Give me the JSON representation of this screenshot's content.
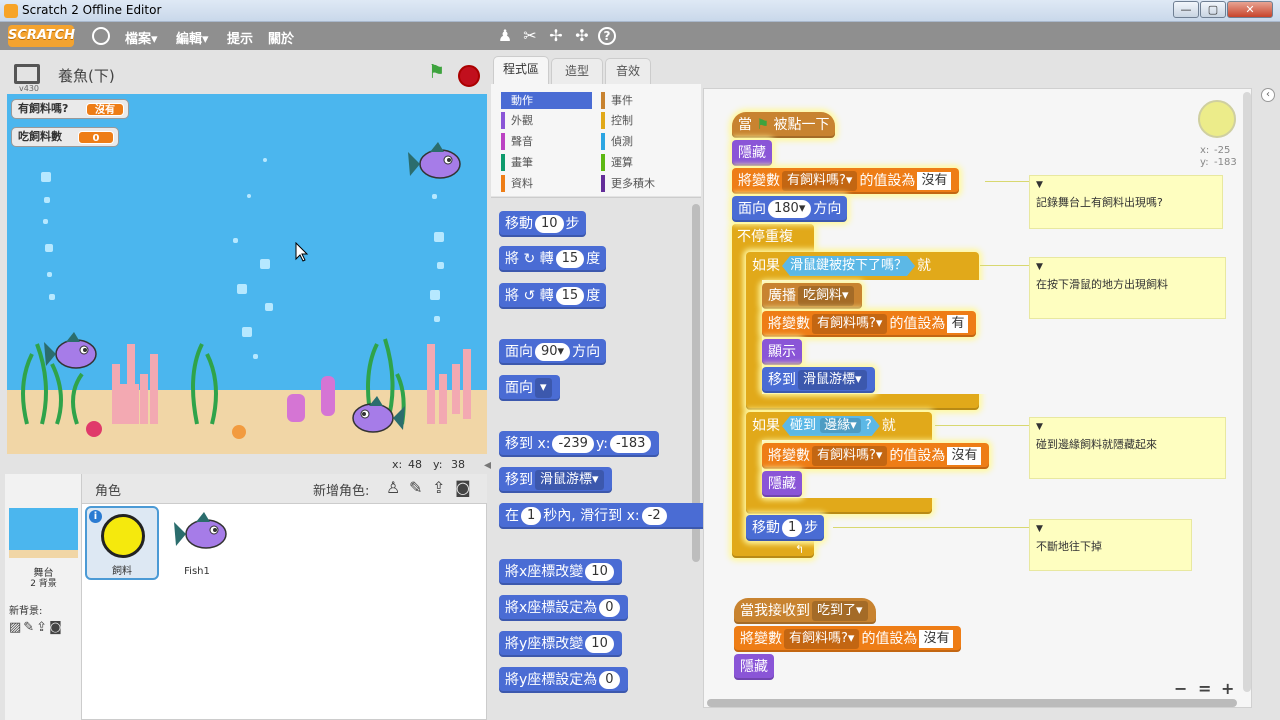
{
  "window": {
    "title": "Scratch 2 Offline Editor",
    "min": "—",
    "max": "▢",
    "close": "✕"
  },
  "menubar": {
    "logo": "SCRATCH",
    "items": [
      "檔案▾",
      "編輯▾",
      "提示",
      "關於"
    ],
    "tools": [
      "duplicate-stamp-icon",
      "cut-scissors-icon",
      "grow-icon",
      "shrink-icon",
      "help-icon"
    ]
  },
  "stage": {
    "title": "養魚(下)",
    "version": "v430",
    "watchers": [
      {
        "label": "有飼料嗎?",
        "value": "沒有"
      },
      {
        "label": "吃飼料數",
        "value": "0"
      }
    ],
    "mouse_x_label": "x:",
    "mouse_x": "48",
    "mouse_y_label": "y:",
    "mouse_y": "38"
  },
  "sprites": {
    "header": "角色",
    "new_sprite_label": "新增角色:",
    "stage_label": "舞台",
    "stage_backdrops": "2 背景",
    "new_backdrop_label": "新背景:",
    "list": [
      {
        "name": "飼料",
        "selected": true
      },
      {
        "name": "Fish1",
        "selected": false
      }
    ]
  },
  "tabs": [
    "程式區",
    "造型",
    "音效"
  ],
  "categories": [
    {
      "name": "動作",
      "color": "#4a6cd4",
      "active": true
    },
    {
      "name": "事件",
      "color": "#c88330"
    },
    {
      "name": "外觀",
      "color": "#8a55d7"
    },
    {
      "name": "控制",
      "color": "#e1a91a"
    },
    {
      "name": "聲音",
      "color": "#bb42c3"
    },
    {
      "name": "偵測",
      "color": "#2ca5e2"
    },
    {
      "name": "畫筆",
      "color": "#0e9a6c"
    },
    {
      "name": "運算",
      "color": "#5cb712"
    },
    {
      "name": "資料",
      "color": "#ee7d16"
    },
    {
      "name": "更多積木",
      "color": "#632d99"
    }
  ],
  "palette": {
    "move": {
      "a": "移動",
      "n": "10",
      "b": "步"
    },
    "turn_cw": {
      "a": "將",
      "icon": "↻",
      "b": "轉",
      "n": "15",
      "c": "度"
    },
    "turn_ccw": {
      "a": "將",
      "icon": "↺",
      "b": "轉",
      "n": "15",
      "c": "度"
    },
    "point_dir": {
      "a": "面向",
      "n": "90▾",
      "b": "方向"
    },
    "point_to": {
      "a": "面向",
      "d": "▾"
    },
    "goto_xy": {
      "a": "移到 x:",
      "x": "-239",
      "b": "y:",
      "y": "-183"
    },
    "goto": {
      "a": "移到",
      "d": "滑鼠游標▾"
    },
    "glide": {
      "a": "在",
      "n": "1",
      "b": "秒內, 滑行到 x:",
      "x": "-2"
    },
    "change_x": {
      "a": "將x座標改變",
      "n": "10"
    },
    "set_x": {
      "a": "將x座標設定為",
      "n": "0"
    },
    "change_y": {
      "a": "將y座標改變",
      "n": "10"
    },
    "set_y": {
      "a": "將y座標設定為",
      "n": "0"
    }
  },
  "script1": {
    "hat_a": "當",
    "hat_b": "被點一下",
    "hide1": "隱藏",
    "set1": {
      "a": "將變數",
      "d": "有飼料嗎?▾",
      "b": "的值設為",
      "v": "沒有"
    },
    "point": {
      "a": "面向",
      "n": "180▾",
      "b": "方向"
    },
    "forever": "不停重複",
    "if1": {
      "a": "如果",
      "cond": "滑鼠鍵被按下了嗎？",
      "b": "就"
    },
    "broadcast": {
      "a": "廣播",
      "d": "吃飼料▾"
    },
    "set2": {
      "a": "將變數",
      "d": "有飼料嗎?▾",
      "b": "的值設為",
      "v": "有"
    },
    "show": "顯示",
    "goto": {
      "a": "移到",
      "d": "滑鼠游標▾"
    },
    "if2": {
      "a": "如果",
      "c1": "碰到",
      "d": "邊緣▾",
      "c2": "?",
      "b": "就"
    },
    "set3": {
      "a": "將變數",
      "d": "有飼料嗎?▾",
      "b": "的值設為",
      "v": "沒有"
    },
    "hide2": "隱藏",
    "move": {
      "a": "移動",
      "n": "1",
      "b": "步"
    }
  },
  "script2": {
    "hat": {
      "a": "當我接收到",
      "d": "吃到了▾"
    },
    "set": {
      "a": "將變數",
      "d": "有飼料嗎?▾",
      "b": "的值設為",
      "v": "沒有"
    },
    "hide": "隱藏"
  },
  "comments": [
    "記錄舞台上有飼料出現嗎?",
    "在按下滑鼠的地方出現飼料",
    "碰到邊緣飼料就隱藏起來",
    "不斷地往下掉"
  ],
  "sprite_info": {
    "x_label": "x:",
    "x": "-25",
    "y_label": "y:",
    "y": "-183"
  },
  "zoom": {
    "out": "−",
    "reset": "=",
    "in": "+"
  }
}
